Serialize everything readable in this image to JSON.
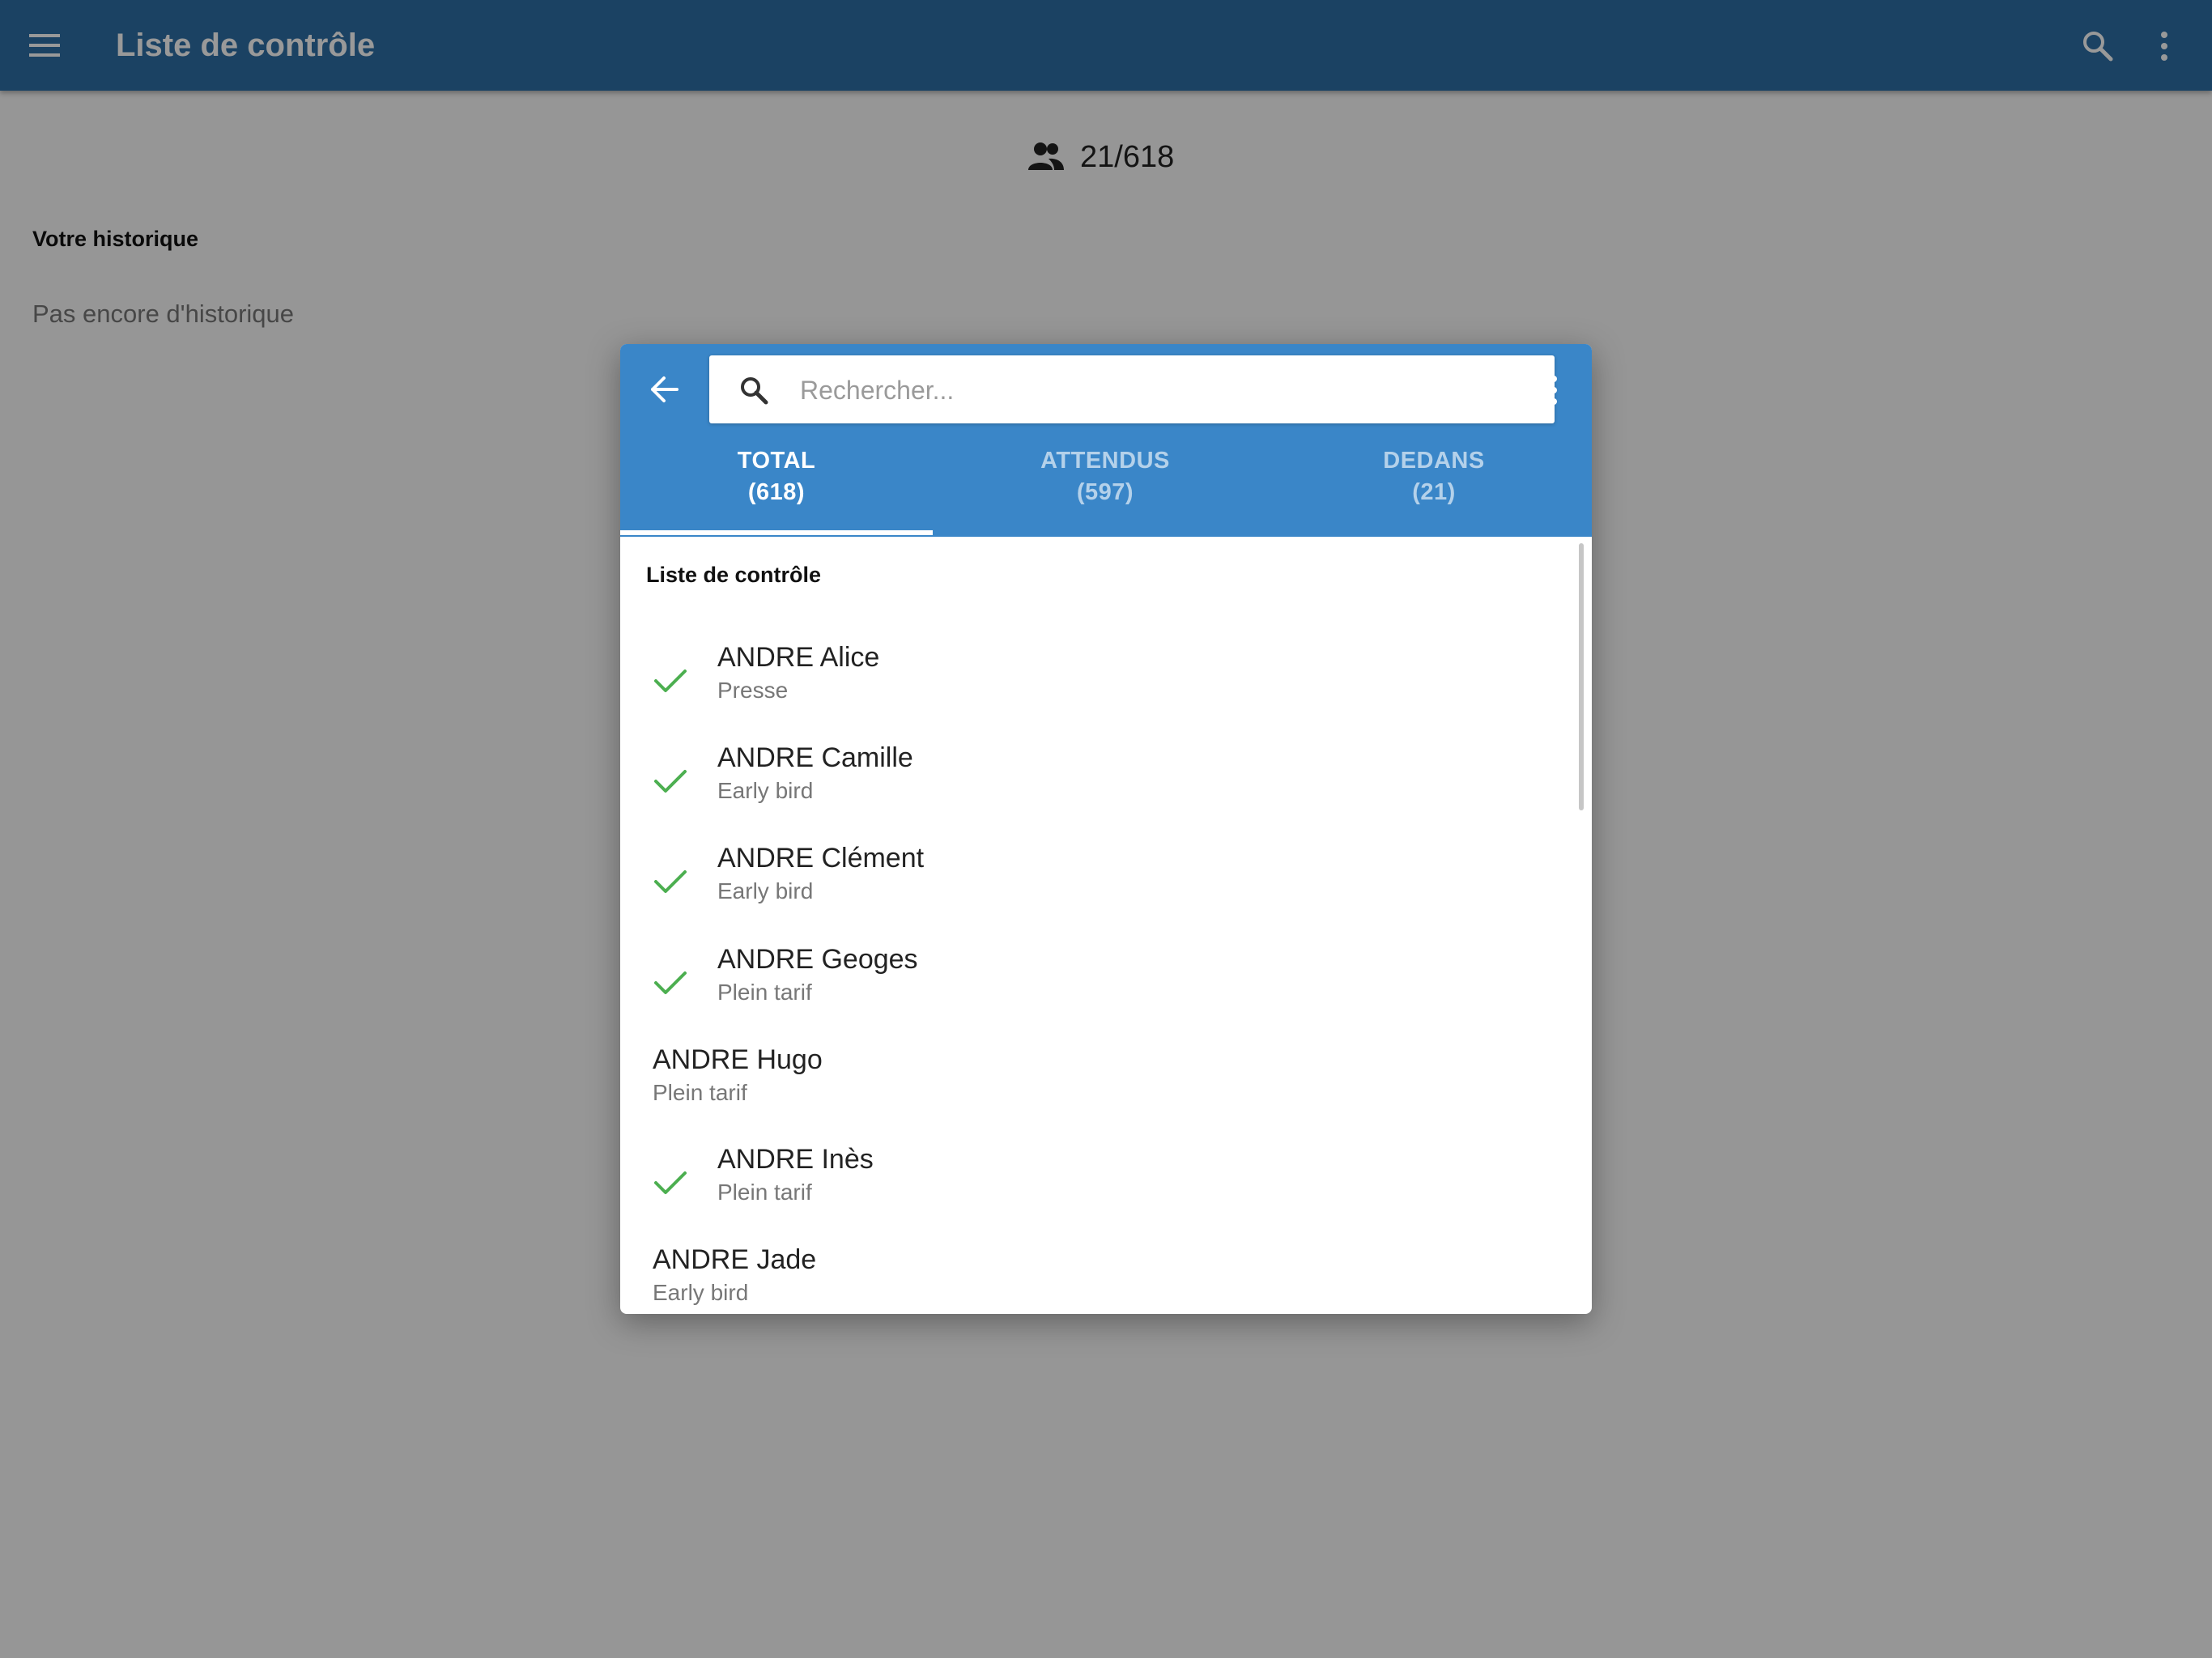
{
  "appbar": {
    "title": "Liste de contrôle",
    "menu_icon": "menu-icon",
    "search_icon": "search-icon",
    "more_icon": "more-vert-icon"
  },
  "summary": {
    "count_text": "21/618",
    "icon": "people-icon"
  },
  "history": {
    "title": "Votre historique",
    "empty_text": "Pas encore d'historique"
  },
  "dialog": {
    "back_icon": "arrow-back-icon",
    "search": {
      "placeholder": "Rechercher...",
      "value": ""
    },
    "more_icon": "more-vert-icon",
    "tabs": [
      {
        "label": "TOTAL",
        "count": "(618)",
        "active": true
      },
      {
        "label": "ATTENDUS",
        "count": "(597)",
        "active": false
      },
      {
        "label": "DEDANS",
        "count": "(21)",
        "active": false
      }
    ],
    "list_title": "Liste de contrôle",
    "items": [
      {
        "name": "ANDRE Alice",
        "category": "Presse",
        "checked": true
      },
      {
        "name": "ANDRE Camille",
        "category": "Early bird",
        "checked": true
      },
      {
        "name": "ANDRE Clément",
        "category": "Early bird",
        "checked": true
      },
      {
        "name": "ANDRE Geoges",
        "category": "Plein tarif",
        "checked": true
      },
      {
        "name": "ANDRE Hugo",
        "category": "Plein tarif",
        "checked": false
      },
      {
        "name": "ANDRE Inès",
        "category": "Plein tarif",
        "checked": true
      },
      {
        "name": "ANDRE Jade",
        "category": "Early bird",
        "checked": false
      }
    ]
  },
  "colors": {
    "appbar": "#2d6fa6",
    "dialog_header": "#3a86c8",
    "check": "#4caf50"
  }
}
